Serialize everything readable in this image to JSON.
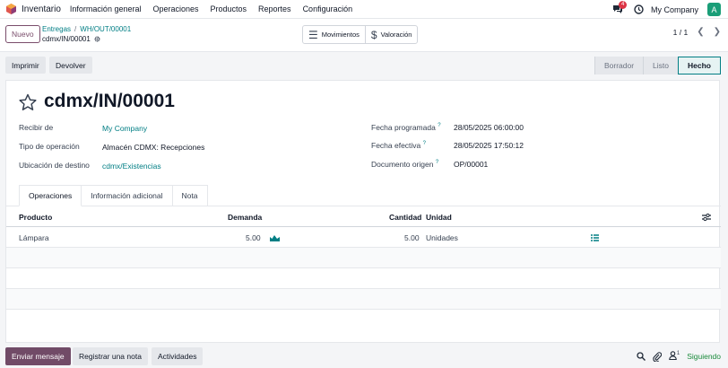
{
  "app": {
    "name": "Inventario"
  },
  "nav": {
    "items": [
      "Información general",
      "Operaciones",
      "Productos",
      "Reportes",
      "Configuración"
    ]
  },
  "header_right": {
    "chat_badge": "4",
    "company": "My Company",
    "avatar_letter": "A"
  },
  "control_panel": {
    "new_label": "Nuevo",
    "breadcrumb": [
      "Entregas",
      "WH/OUT/00001"
    ],
    "current_record": "cdmx/IN/00001",
    "smart_buttons": [
      {
        "label": "Movimientos",
        "icon": "list-icon"
      },
      {
        "label": "Valoración",
        "icon": "dollar-icon"
      }
    ],
    "pager": "1 / 1"
  },
  "statusbar": {
    "buttons": [
      "Imprimir",
      "Devolver"
    ],
    "stages": [
      "Borrador",
      "Listo",
      "Hecho"
    ],
    "active_stage": "Hecho"
  },
  "record": {
    "title": "cdmx/IN/00001",
    "left_fields": [
      {
        "label": "Recibir de",
        "value": "My Company"
      },
      {
        "label": "Tipo de operación",
        "value": "Almacén CDMX: Recepciones"
      },
      {
        "label": "Ubicación de destino",
        "value": "cdmx/Existencias"
      }
    ],
    "right_fields": [
      {
        "label": "Fecha programada",
        "value": "28/05/2025 06:00:00"
      },
      {
        "label": "Fecha efectiva",
        "value": "28/05/2025 17:50:12"
      },
      {
        "label": "Documento origen",
        "value": "OP/00001"
      }
    ],
    "help_mark": "?"
  },
  "tabs": [
    "Operaciones",
    "Información adicional",
    "Nota"
  ],
  "table": {
    "headers": [
      "Producto",
      "Demanda",
      "Cantidad",
      "Unidad"
    ],
    "rows": [
      {
        "product": "Lámpara",
        "demand": "5.00",
        "quantity": "5.00",
        "unit": "Unidades"
      }
    ]
  },
  "chatter": {
    "buttons": [
      "Enviar mensaje",
      "Registrar una nota",
      "Actividades"
    ],
    "followers_count": "1",
    "following_label": "Siguiendo"
  },
  "colors": {
    "brand": "#714b67",
    "link": "#017e84",
    "badge": "#dc3545",
    "avatar": "#1a9e78",
    "following": "#1a8a3a"
  }
}
